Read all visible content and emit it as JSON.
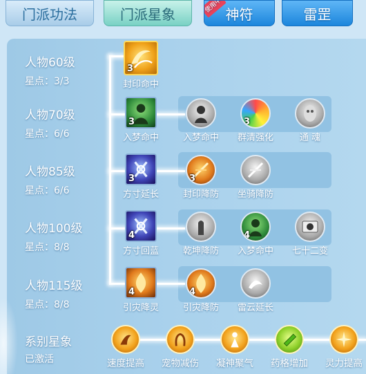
{
  "tabs": [
    {
      "label": "门派功法",
      "state": "inactive"
    },
    {
      "label": "门派星象",
      "state": "active"
    },
    {
      "label": "神符",
      "state": "highlight",
      "badge": "使用中"
    },
    {
      "label": "雷罡",
      "state": "highlight"
    }
  ],
  "rows": [
    {
      "title": "人物60级",
      "stars": "星点：3/3",
      "nodes": [
        {
          "label": "封印命中",
          "level": "3",
          "icon": "gold-swirl-icon"
        }
      ]
    },
    {
      "title": "人物70级",
      "stars": "星点：6/6",
      "nodes": [
        {
          "label": "入梦命中",
          "level": "3",
          "icon": "green-figure-icon"
        },
        {
          "label": "入梦命中",
          "level": "",
          "icon": "grey-figure-icon"
        },
        {
          "label": "群清强化",
          "level": "3",
          "icon": "rainbow-orb-icon"
        },
        {
          "label": "通 魂",
          "level": "",
          "icon": "grey-soul-icon"
        }
      ]
    },
    {
      "title": "人物85级",
      "stars": "星点：6/6",
      "nodes": [
        {
          "label": "方寸延长",
          "level": "3",
          "icon": "purple-rune-icon"
        },
        {
          "label": "封印降防",
          "level": "3",
          "icon": "fire-sword-icon"
        },
        {
          "label": "坐骑降防",
          "level": "",
          "icon": "grey-sword-icon"
        }
      ]
    },
    {
      "title": "人物100级",
      "stars": "星点：8/8",
      "nodes": [
        {
          "label": "方寸回蓝",
          "level": "4",
          "icon": "purple-rune-icon"
        },
        {
          "label": "乾坤降防",
          "level": "",
          "icon": "grey-hand-icon"
        },
        {
          "label": "入梦命中",
          "level": "4",
          "icon": "green-figure-icon"
        },
        {
          "label": "七十二变",
          "level": "",
          "icon": "grey-taiji-icon"
        }
      ]
    },
    {
      "title": "人物115级",
      "stars": "星点：8/8",
      "nodes": [
        {
          "label": "引灾降灵",
          "level": "4",
          "icon": "orange-flame-icon"
        },
        {
          "label": "引灾降防",
          "level": "4",
          "icon": "orange-flame-icon"
        },
        {
          "label": "雷云延长",
          "level": "",
          "icon": "grey-cloud-icon"
        }
      ]
    }
  ],
  "series": {
    "title": "系别星象",
    "status": "已激活",
    "nodes": [
      {
        "label": "速度提高",
        "icon": "speed-icon"
      },
      {
        "label": "宠物减伤",
        "icon": "pet-shield-icon"
      },
      {
        "label": "凝神聚气",
        "icon": "focus-icon"
      },
      {
        "label": "药格增加",
        "icon": "medicine-icon"
      },
      {
        "label": "灵力提高",
        "icon": "spirit-icon"
      }
    ]
  },
  "colors": {
    "panel": "#a9d1ec",
    "active_tab": "#79d1c4",
    "highlight_tab": "#1c86dc"
  }
}
